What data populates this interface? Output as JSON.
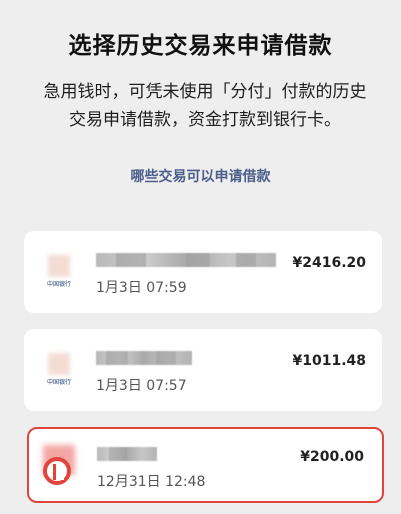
{
  "page": {
    "title": "选择历史交易来申请借款",
    "description": "急用钱时，可凭未使用「分付」付款的历史交易申请借款，资金打款到银行卡。",
    "help_link": "哪些交易可以申请借款"
  },
  "transactions": [
    {
      "merchant_label": "中国银行",
      "time": "1月3日 07:59",
      "amount": "¥2416.20",
      "selected": false
    },
    {
      "merchant_label": "中国银行",
      "time": "1月3日 07:57",
      "amount": "¥1011.48",
      "selected": false
    },
    {
      "time": "12月31日 12:48",
      "amount": "¥200.00",
      "selected": true
    }
  ],
  "colors": {
    "background": "#eeeeee",
    "card": "#ffffff",
    "link": "#4b5e8a",
    "selected_border": "#e0453b"
  }
}
